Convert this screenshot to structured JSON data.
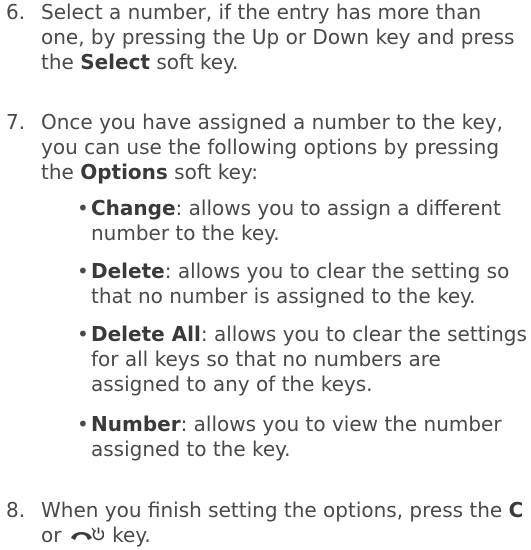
{
  "steps": [
    {
      "number": "6.",
      "text_before": "Select a number, if the entry has more than one, by pressing the Up or Down key and press the ",
      "bold": "Select",
      "text_after": " soft key."
    },
    {
      "number": "7.",
      "text_before": "Once you have assigned a number to the key, you can use the following options by pressing the ",
      "bold": "Options",
      "text_after": " soft key:"
    },
    {
      "number": "8.",
      "text_before": "When you finish setting the options, press the ",
      "bold": "C",
      "text_middle": " or ",
      "text_after": " key.",
      "icon": "end-call-power-key-icon"
    }
  ],
  "bullets": [
    {
      "term": "Change",
      "description": ": allows you to assign a different number to the key."
    },
    {
      "term": "Delete",
      "description": ": allows you to clear the setting so that no number is assigned to the key."
    },
    {
      "term": "Delete All",
      "description": ": allows you to clear the settings for all keys so that no numbers are assigned to any of the keys."
    },
    {
      "term": "Number",
      "description": ": allows you to view the number assigned to the key."
    }
  ],
  "bullet_symbol": "•",
  "colors": {
    "text": "#4a4a4a",
    "bold": "#3a3a3a"
  }
}
